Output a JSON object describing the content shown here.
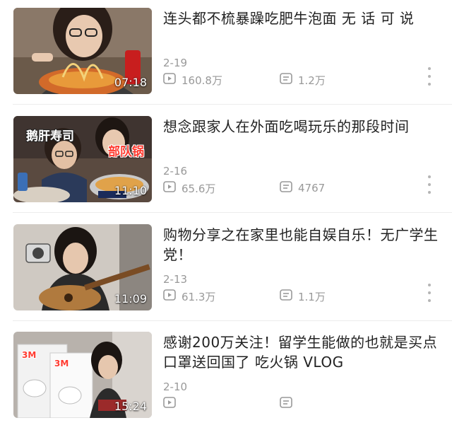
{
  "videos": [
    {
      "title": "连头都不梳暴躁吃肥牛泡面 无 话 可 说",
      "duration": "07:18",
      "date": "2-19",
      "views": "160.8万",
      "comments": "1.2万",
      "thumb_text": []
    },
    {
      "title": "想念跟家人在外面吃喝玩乐的那段时间",
      "duration": "11:10",
      "date": "2-16",
      "views": "65.6万",
      "comments": "4767",
      "thumb_text": [
        "鹅肝寿司",
        "部队锅"
      ]
    },
    {
      "title": "购物分享之在家里也能自娱自乐！无广学生党！",
      "duration": "11:09",
      "date": "2-13",
      "views": "61.3万",
      "comments": "1.1万",
      "thumb_text": []
    },
    {
      "title": "感谢200万关注！留学生能做的也就是买点口罩送回国了 吃火锅 VLOG",
      "duration": "15:24",
      "date": "2-10",
      "views": "",
      "comments": "",
      "thumb_text": [
        "3M",
        "3M"
      ]
    }
  ],
  "icons": {
    "views": "play-count-icon",
    "comments": "comment-count-icon",
    "more": "more-vertical-icon"
  },
  "colors": {
    "title": "#222222",
    "meta": "#999999",
    "more_dots": "#b5b5b5"
  }
}
